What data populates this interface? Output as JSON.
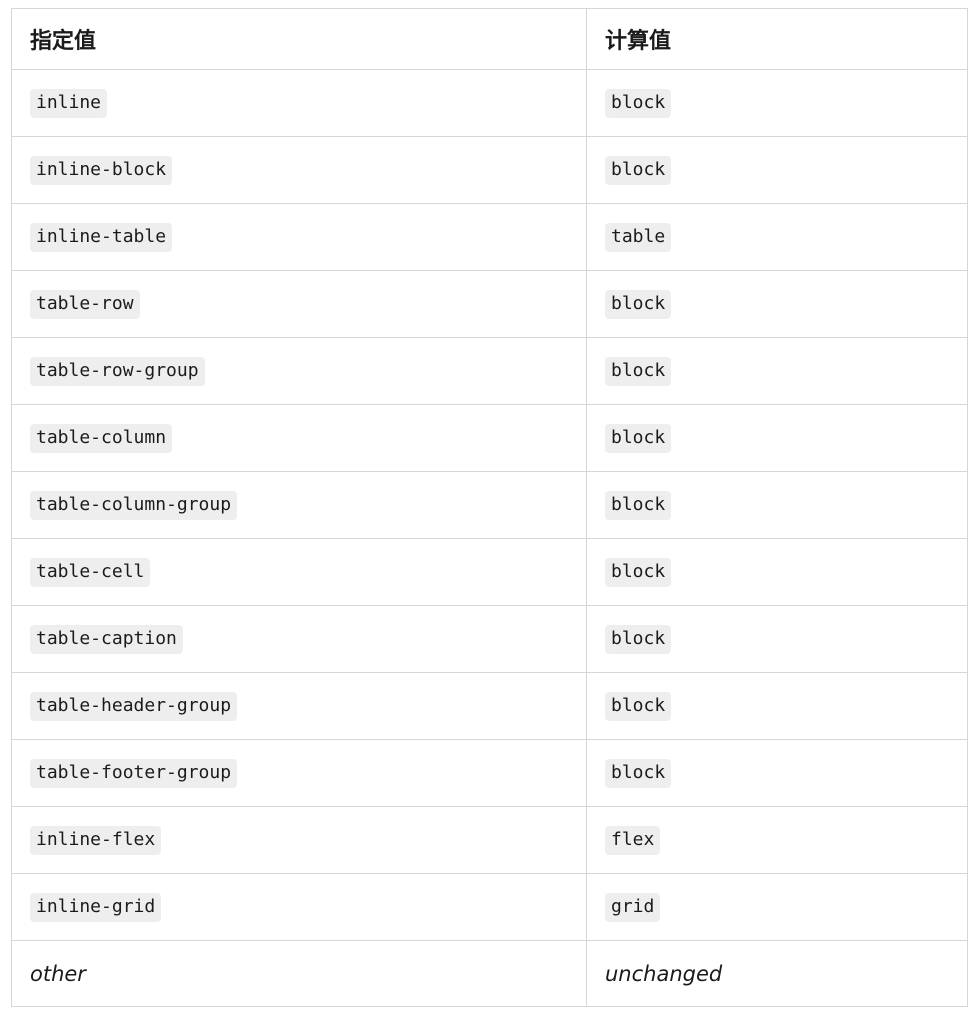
{
  "table": {
    "headers": [
      "指定值",
      "计算值"
    ],
    "rows": [
      {
        "specified": "inline",
        "computed": "block"
      },
      {
        "specified": "inline-block",
        "computed": "block"
      },
      {
        "specified": "inline-table",
        "computed": "table"
      },
      {
        "specified": "table-row",
        "computed": "block"
      },
      {
        "specified": "table-row-group",
        "computed": "block"
      },
      {
        "specified": "table-column",
        "computed": "block"
      },
      {
        "specified": "table-column-group",
        "computed": "block"
      },
      {
        "specified": "table-cell",
        "computed": "block"
      },
      {
        "specified": "table-caption",
        "computed": "block"
      },
      {
        "specified": "table-header-group",
        "computed": "block"
      },
      {
        "specified": "table-footer-group",
        "computed": "block"
      },
      {
        "specified": "inline-flex",
        "computed": "flex"
      },
      {
        "specified": "inline-grid",
        "computed": "grid"
      },
      {
        "specified": "other",
        "computed": "unchanged"
      }
    ]
  }
}
